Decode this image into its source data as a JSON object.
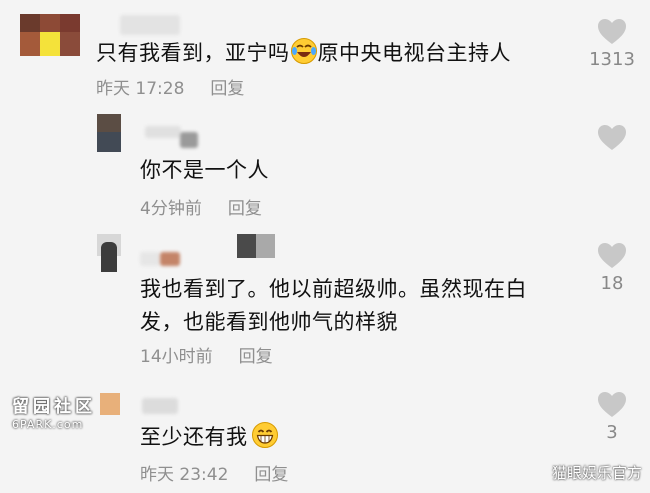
{
  "comments": [
    {
      "text": "只有我看到，亚宁吗",
      "text_after_emoji": "原中央电视台主持人",
      "time": "昨天 17:28",
      "reply_label": "回复",
      "likes": "1313",
      "emoji": "laughing-tears-emoji"
    },
    {
      "text": "你不是一个人",
      "time": "4分钟前",
      "reply_label": "回复",
      "likes": ""
    },
    {
      "text_line1": "我也看到了。他以前超级帅。虽然现在白",
      "text_line2": "发，也能看到他帅气的样貌",
      "time": "14小时前",
      "reply_label": "回复",
      "likes": "18"
    },
    {
      "text": "至少还有我",
      "time": "昨天 23:42",
      "reply_label": "回复",
      "likes": "3",
      "emoji": "grinning-emoji"
    }
  ],
  "watermarks": {
    "left_line1": "留园社区",
    "left_line2": "6PARK.com",
    "right": "猫眼娱乐官方"
  },
  "colors": {
    "background": "#f4f4f4",
    "meta_text": "#8f8f8f",
    "heart": "#c8c8c8"
  }
}
